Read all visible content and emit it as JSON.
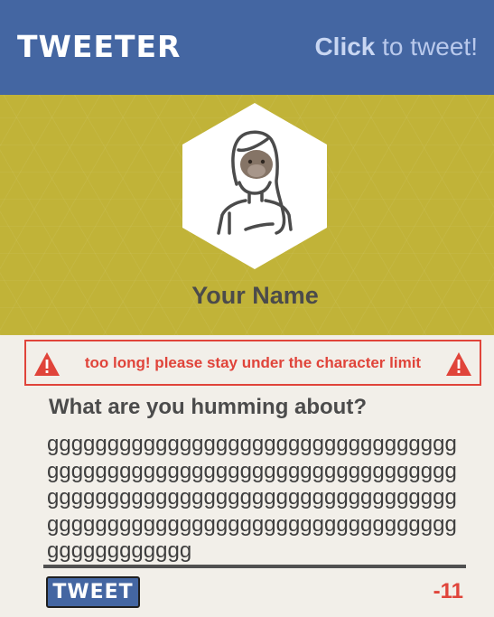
{
  "header": {
    "logo": "TWEETER",
    "tagline_strong": "Click",
    "tagline_rest": " to tweet!"
  },
  "profile": {
    "avatar_icon": "person-avatar-icon",
    "display_name": "Your Name"
  },
  "alert": {
    "icon": "warning-triangle-icon",
    "message": "too long! please stay under the character limit"
  },
  "composer": {
    "prompt": "What are you humming about?",
    "value": "gggggggggggggggggggggggggggggggggggggggggggggggggggggggggggggggggggggggggggggggggggggggggggggggggggggggggggggggggggggggggggggggggggggggggggggggggggg",
    "submit_label": "TWEET",
    "remaining": "-11"
  },
  "colors": {
    "header_bg": "#4466a2",
    "profile_bg": "#c1b338",
    "page_bg": "#f2efe9",
    "error": "#e0443a",
    "text_dark": "#4b4b4b"
  }
}
